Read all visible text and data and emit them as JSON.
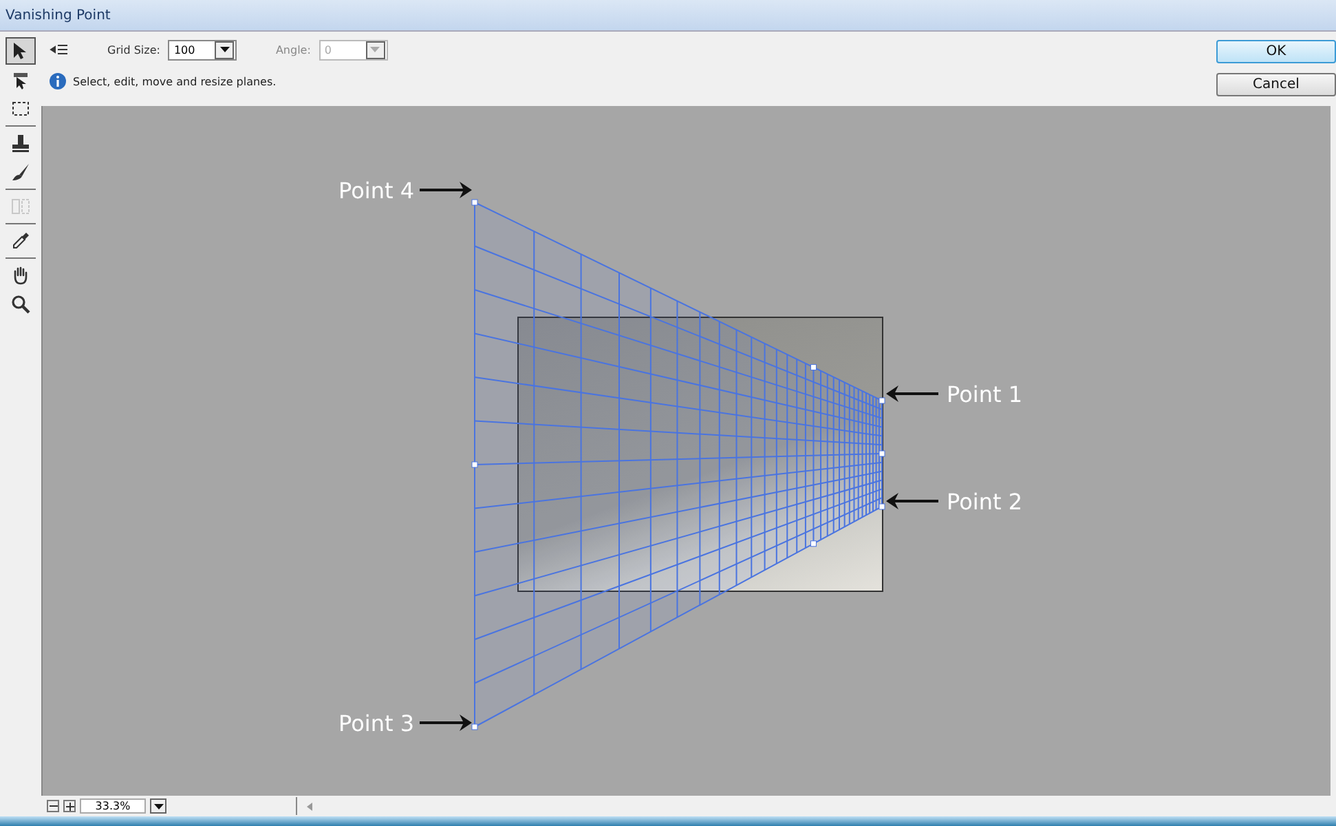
{
  "window": {
    "title": "Vanishing Point"
  },
  "tools": [
    {
      "kind": "edit-plane",
      "selected": true,
      "disabled": false
    },
    {
      "kind": "create-plane",
      "selected": false,
      "disabled": false
    },
    {
      "kind": "marquee",
      "selected": false,
      "disabled": false
    },
    {
      "kind": "stamp",
      "selected": false,
      "disabled": false
    },
    {
      "kind": "brush",
      "selected": false,
      "disabled": false
    },
    {
      "kind": "transform",
      "selected": false,
      "disabled": true
    },
    {
      "kind": "eyedropper",
      "selected": false,
      "disabled": false
    },
    {
      "kind": "hand",
      "selected": false,
      "disabled": false
    },
    {
      "kind": "zoom",
      "selected": false,
      "disabled": false
    }
  ],
  "options": {
    "grid_size": {
      "label": "Grid Size:",
      "value": "100"
    },
    "angle": {
      "label": "Angle:",
      "value": "0",
      "disabled": true
    }
  },
  "hint": "Select, edit, move and resize planes.",
  "buttons": [
    {
      "label": "OK",
      "default": true
    },
    {
      "label": "Cancel",
      "default": false
    }
  ],
  "annotations": [
    {
      "label": "Point 4"
    },
    {
      "label": "Point 1"
    },
    {
      "label": "Point 2"
    },
    {
      "label": "Point 3"
    }
  ],
  "status_bar": {
    "zoom": "33.3%"
  }
}
